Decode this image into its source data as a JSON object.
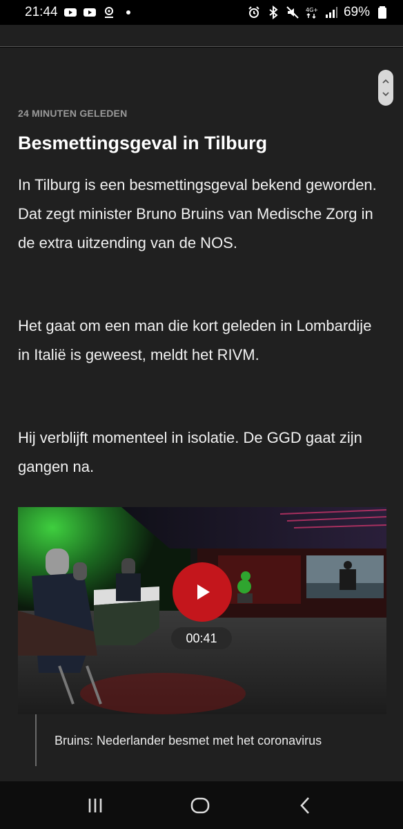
{
  "status_bar": {
    "time": "21:44",
    "battery": "69%",
    "left_icons": [
      "youtube-icon",
      "youtube-icon",
      "location-icon",
      "dot-icon"
    ],
    "right_icons": [
      "alarm-icon",
      "bluetooth-icon",
      "mute-icon",
      "network-4g-icon",
      "signal-icon",
      "battery-icon"
    ]
  },
  "article": {
    "timestamp": "24 MINUTEN GELEDEN",
    "title": "Besmettingsgeval in Tilburg",
    "paragraphs": [
      "In Tilburg is een besmettingsgeval bekend geworden. Dat zegt minister Bruno Bruins van Medische Zorg in de extra uitzending van de NOS.",
      "Het gaat om een man die kort geleden in Lombardije in Italië is geweest, meldt het RIVM.",
      "Hij verblijft momenteel in isolatie. De GGD gaat zijn gangen na."
    ],
    "video": {
      "duration": "00:41",
      "caption": "Bruins: Nederlander besmet met het coronavirus"
    }
  },
  "nav_bar": {
    "buttons": [
      "recent-apps-icon",
      "home-icon",
      "back-icon"
    ]
  },
  "colors": {
    "background": "#202020",
    "play_button": "#c4161c"
  }
}
